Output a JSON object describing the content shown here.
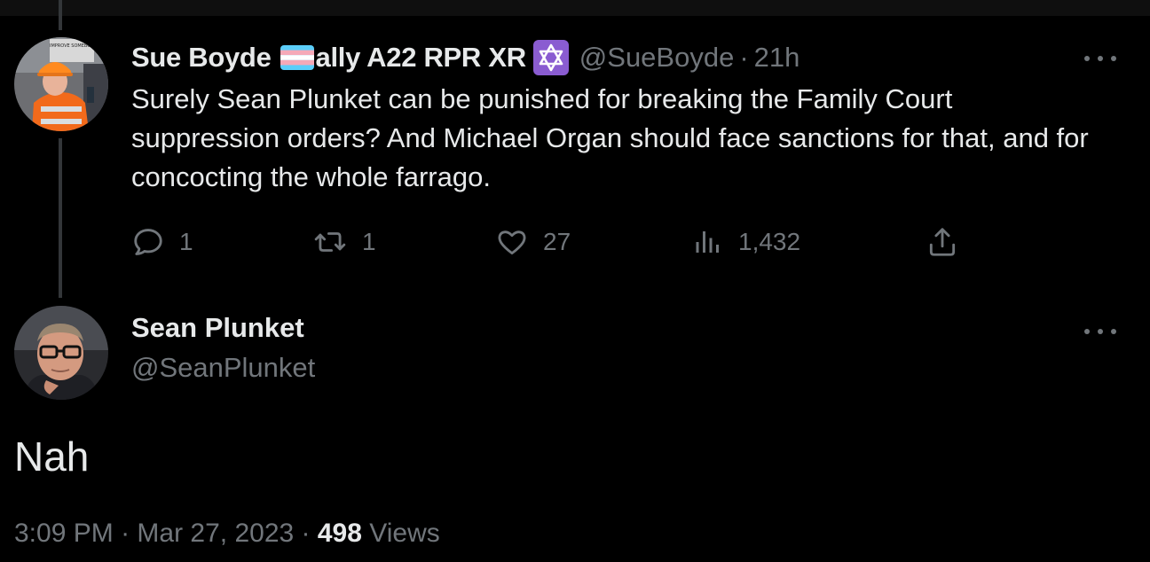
{
  "reply_to": {
    "author_name": "Sue Boyde",
    "name_suffix": "ally A22 RPR XR",
    "handle": "@SueBoyde",
    "time": "21h",
    "text": "Surely Sean Plunket can be punished for breaking the Family Court suppression orders? And Michael Organ should face sanctions for that, and for concocting the whole farrago.",
    "avatar_sign_text": "IMPROVE SOMEBOD",
    "icons": [
      "transgender-flag-icon",
      "star-of-david-icon",
      "more-icon"
    ],
    "actions": {
      "replies": "1",
      "retweets": "1",
      "likes": "27",
      "views": "1,432"
    }
  },
  "tweet": {
    "author_name": "Sean Plunket",
    "handle": "@SeanPlunket",
    "text": "Nah",
    "time": "3:09 PM",
    "date": "Mar 27, 2023",
    "views_count": "498",
    "views_label": "Views"
  },
  "colors": {
    "background": "#000000",
    "text_primary": "#e7e9ea",
    "text_secondary": "#71767b",
    "thread_line": "#333639",
    "badge_purple": "#8a5cd1"
  }
}
